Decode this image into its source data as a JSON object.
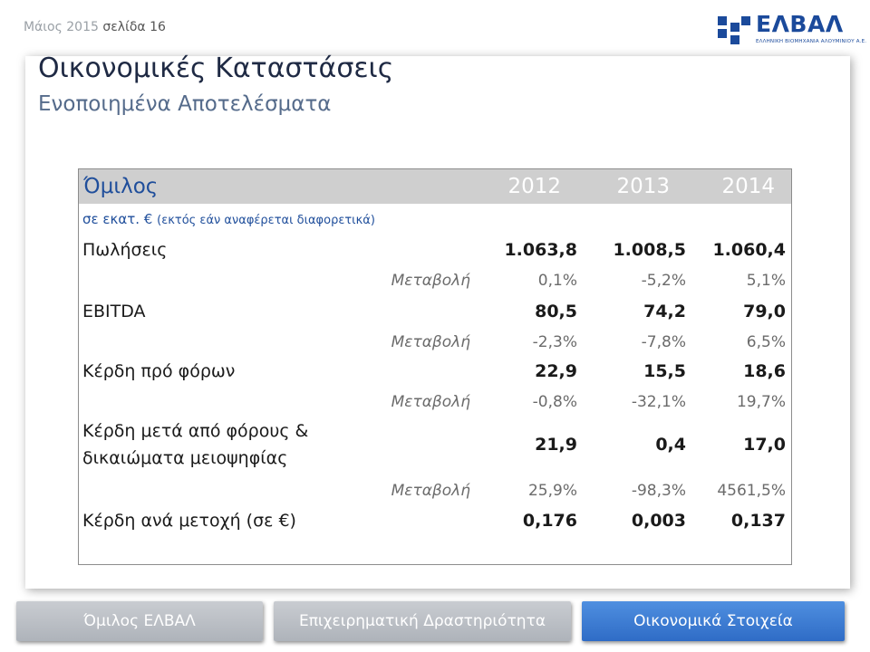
{
  "header": {
    "date": "Μάιος 2015",
    "page": "σελίδα 16"
  },
  "logo": {
    "brand": "ΕΛΒΑΛ",
    "tagline": "ΕΛΛΗΝΙΚΗ ΒΙΟΜΗΧΑΝΙΑ ΑΛΟΥΜΙΝΙΟΥ Α.Ε."
  },
  "title": "Οικονομικές Καταστάσεις",
  "subtitle": "Ενοποιημένα Αποτελέσματα",
  "table": {
    "header_label": "Όμιλος",
    "years": [
      "2012",
      "2013",
      "2014"
    ],
    "unit_main": "σε εκατ. €",
    "unit_note": "(εκτός εάν αναφέρεται διαφορετικά)",
    "change_label": "Μεταβολή",
    "rows": [
      {
        "label": "Πωλήσεις",
        "values": [
          "1.063,8",
          "1.008,5",
          "1.060,4"
        ],
        "changes": [
          "0,1%",
          "-5,2%",
          "5,1%"
        ]
      },
      {
        "label": "EBITDA",
        "values": [
          "80,5",
          "74,2",
          "79,0"
        ],
        "changes": [
          "-2,3%",
          "-7,8%",
          "6,5%"
        ]
      },
      {
        "label": "Κέρδη πρό φόρων",
        "values": [
          "22,9",
          "15,5",
          "18,6"
        ],
        "changes": [
          "-0,8%",
          "-32,1%",
          "19,7%"
        ]
      },
      {
        "label_line1": "Κέρδη μετά από φόρους &",
        "label_line2": "δικαιώματα μειοψηφίας",
        "values": [
          "21,9",
          "0,4",
          "17,0"
        ],
        "changes": [
          "25,9%",
          "-98,3%",
          "4561,5%"
        ]
      },
      {
        "label": "Κέρδη ανά μετοχή (σε €)",
        "values": [
          "0,176",
          "0,003",
          "0,137"
        ]
      }
    ]
  },
  "nav": [
    {
      "label": "Όμιλος ΕΛΒΑΛ",
      "active": false
    },
    {
      "label": "Επιχειρηματική Δραστηριότητα",
      "active": false
    },
    {
      "label": "Οικονομικά Στοιχεία",
      "active": true
    }
  ],
  "colors": {
    "accent_blue": "#2f6cc6",
    "title": "#1f2a44",
    "subtitle": "#556b8b",
    "table_header_bg": "#cfcfcf"
  }
}
